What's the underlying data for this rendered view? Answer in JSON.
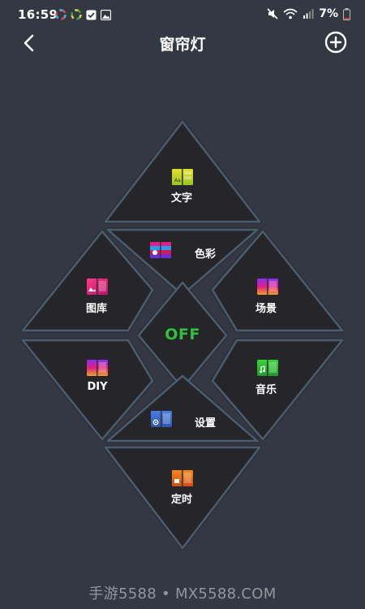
{
  "status_bar": {
    "time": "16:59",
    "battery": "7%"
  },
  "header": {
    "title": "窗帘灯"
  },
  "center": {
    "label": "OFF",
    "color": "#2ec13c"
  },
  "tiles": {
    "text": {
      "label": "文字",
      "icon": "text-mode-icon"
    },
    "color": {
      "label": "色彩",
      "icon": "color-mode-icon"
    },
    "gallery": {
      "label": "图库",
      "icon": "gallery-mode-icon"
    },
    "scene": {
      "label": "场景",
      "icon": "scene-mode-icon"
    },
    "diy": {
      "label": "DIY",
      "icon": "diy-mode-icon"
    },
    "music": {
      "label": "音乐",
      "icon": "music-mode-icon"
    },
    "settings": {
      "label": "设置",
      "icon": "settings-mode-icon"
    },
    "timer": {
      "label": "定时",
      "icon": "timer-mode-icon"
    }
  },
  "watermark": "手游5588 • MX5588.COM"
}
